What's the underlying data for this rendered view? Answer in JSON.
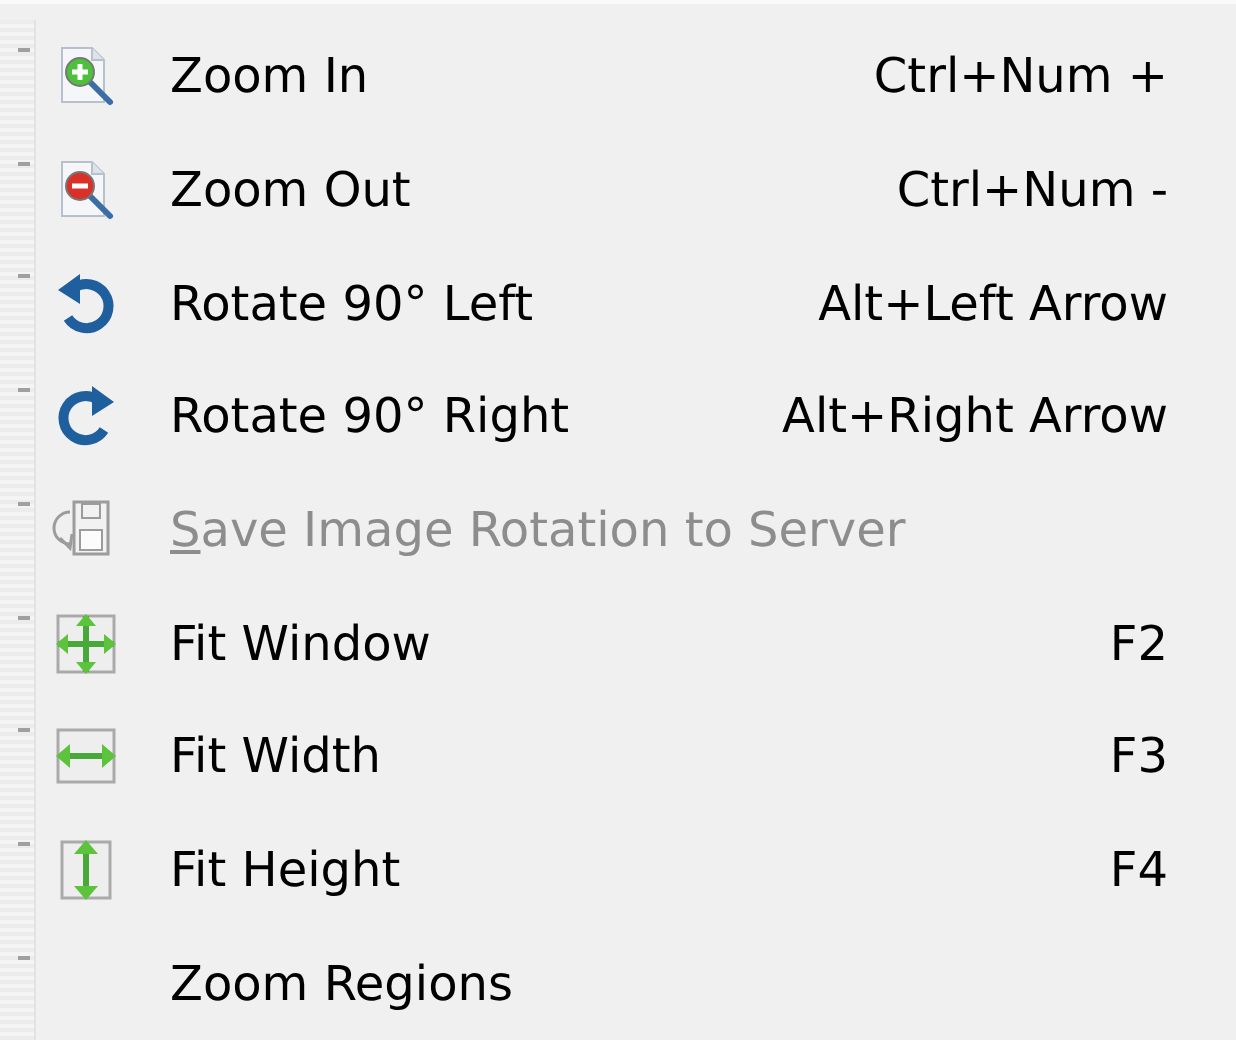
{
  "menu": {
    "items": [
      {
        "kind": "zoom-in",
        "label": "Zoom In",
        "shortcut": "Ctrl+Num +",
        "disabled": false,
        "underline_first": false
      },
      {
        "kind": "zoom-out",
        "label": "Zoom Out",
        "shortcut": "Ctrl+Num -",
        "disabled": false,
        "underline_first": false
      },
      {
        "kind": "rotate-left",
        "label": "Rotate 90° Left",
        "shortcut": "Alt+Left Arrow",
        "disabled": false,
        "underline_first": false
      },
      {
        "kind": "rotate-right",
        "label": "Rotate 90° Right",
        "shortcut": "Alt+Right Arrow",
        "disabled": false,
        "underline_first": false
      },
      {
        "kind": "save",
        "label": "Save Image Rotation to Server",
        "disabled": true,
        "underline_first": true
      },
      {
        "kind": "fit-window",
        "label": "Fit Window",
        "shortcut": "F2",
        "disabled": false,
        "underline_first": false
      },
      {
        "kind": "fit-width",
        "label": "Fit Width",
        "shortcut": "F3",
        "disabled": false,
        "underline_first": false
      },
      {
        "kind": "fit-height",
        "label": "Fit Height",
        "shortcut": "F4",
        "disabled": false,
        "underline_first": false
      },
      {
        "kind": "plain",
        "label": "Zoom Regions",
        "disabled": false,
        "underline_first": false
      }
    ]
  }
}
